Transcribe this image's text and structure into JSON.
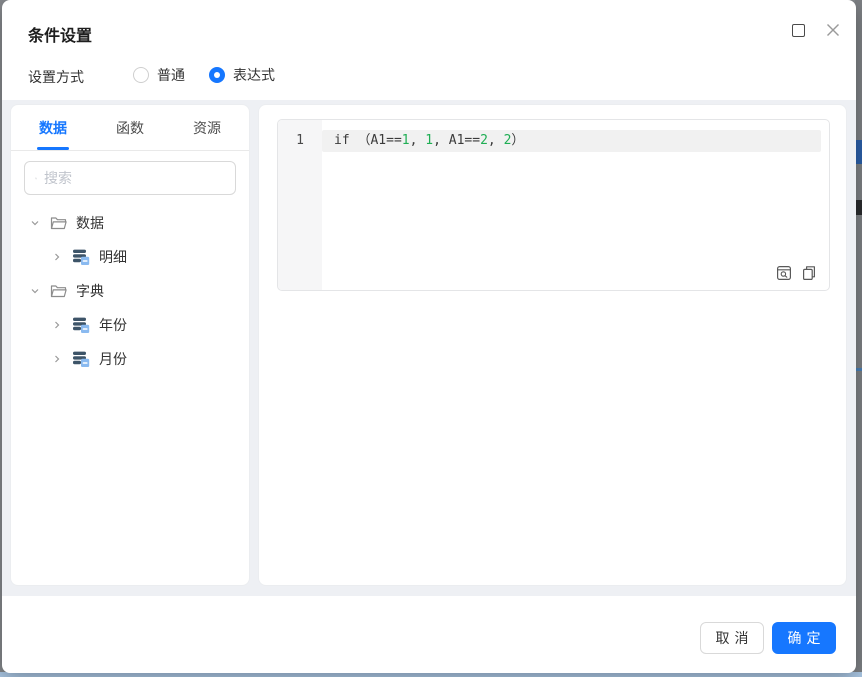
{
  "colors": {
    "accent_blue": "#1677ff",
    "code_number_green": "#1fae54",
    "content_bg": "#eef0f4",
    "edge_bg": "#85888c",
    "bottom_strip_blue": "#aac7e4"
  },
  "dialog": {
    "title": "条件设置",
    "window_controls": {
      "maximize_icon": "maximize-icon",
      "close_icon": "close-icon"
    },
    "settings": {
      "label": "设置方式",
      "options": [
        {
          "label": "普通",
          "selected": false
        },
        {
          "label": "表达式",
          "selected": true
        }
      ]
    },
    "left_panel": {
      "tabs": [
        {
          "label": "数据",
          "active": true
        },
        {
          "label": "函数",
          "active": false
        },
        {
          "label": "资源",
          "active": false
        }
      ],
      "search": {
        "placeholder": "搜索",
        "value": "",
        "icon": "search-icon"
      },
      "tree_rows": [
        {
          "label": "数据",
          "level": 1,
          "icon": "folder-icon",
          "chevron": "down"
        },
        {
          "label": "明细",
          "level": 2,
          "icon": "table-icon",
          "chevron": "right"
        },
        {
          "label": "字典",
          "level": 1,
          "icon": "folder-icon",
          "chevron": "down"
        },
        {
          "label": "年份",
          "level": 2,
          "icon": "table-icon",
          "chevron": "right"
        },
        {
          "label": "月份",
          "level": 2,
          "icon": "table-icon",
          "chevron": "right"
        }
      ]
    },
    "editor": {
      "line_number": "1",
      "segments": [
        {
          "text": "if （A1==",
          "type": "plain"
        },
        {
          "text": "1",
          "type": "number"
        },
        {
          "text": ", ",
          "type": "plain"
        },
        {
          "text": "1",
          "type": "number"
        },
        {
          "text": ", ",
          "type": "plain"
        },
        {
          "text": "A1==",
          "type": "plain"
        },
        {
          "text": "2",
          "type": "number"
        },
        {
          "text": ", ",
          "type": "plain"
        },
        {
          "text": "2",
          "type": "number"
        },
        {
          "text": "）",
          "type": "plain"
        }
      ],
      "toolbar_icons": [
        "preview-icon",
        "copy-icon"
      ]
    },
    "footer": {
      "cancel_label": "取消",
      "ok_label": "确定"
    }
  }
}
